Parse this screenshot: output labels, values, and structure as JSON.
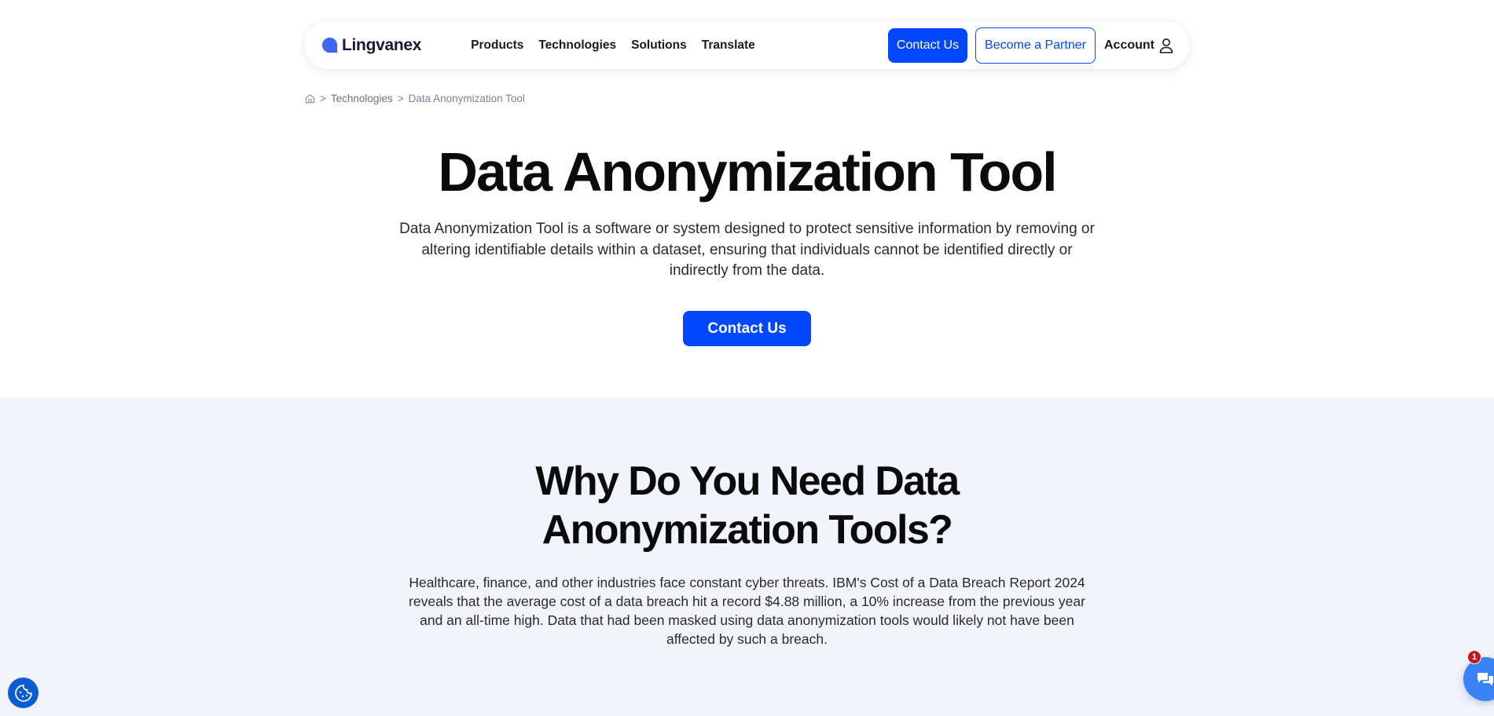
{
  "header": {
    "logo_text": "Lingvanex",
    "nav": [
      "Products",
      "Technologies",
      "Solutions",
      "Translate"
    ],
    "contact_label": "Contact Us",
    "partner_label": "Become a Partner",
    "account_label": "Account"
  },
  "breadcrumb": {
    "separator": ">",
    "items": [
      "Technologies",
      "Data Anonymization Tool"
    ]
  },
  "hero": {
    "title": "Data Anonymization Tool",
    "description": "Data Anonymization Tool is a software or system designed to protect sensitive information by removing or altering identifiable details within a dataset, ensuring that individuals cannot be identified directly or indirectly from the data.",
    "cta_label": "Contact Us"
  },
  "section_why": {
    "title_line1": "Why Do You Need Data",
    "title_line2": "Anonymization Tools?",
    "text": "Healthcare, finance, and other industries face constant cyber threats. IBM's Cost of a Data Breach Report 2024 reveals that the average cost of a data breach hit a record $4.88 million, a 10% increase from the previous year and an all-time high. Data that had been masked using data anonymization tools would likely not have been affected by such a breach."
  },
  "chat": {
    "badge_count": "1"
  },
  "icons": {
    "logo": "lingvanex-logo-icon",
    "account": "user-icon",
    "home": "home-icon",
    "cookie": "cookie-settings-icon",
    "chat": "chat-icon"
  },
  "colors": {
    "brand_blue": "#0047ff",
    "section_bg": "#f1f4fb",
    "badge_red": "#c4161c",
    "chat_blue": "#3b82f6"
  }
}
